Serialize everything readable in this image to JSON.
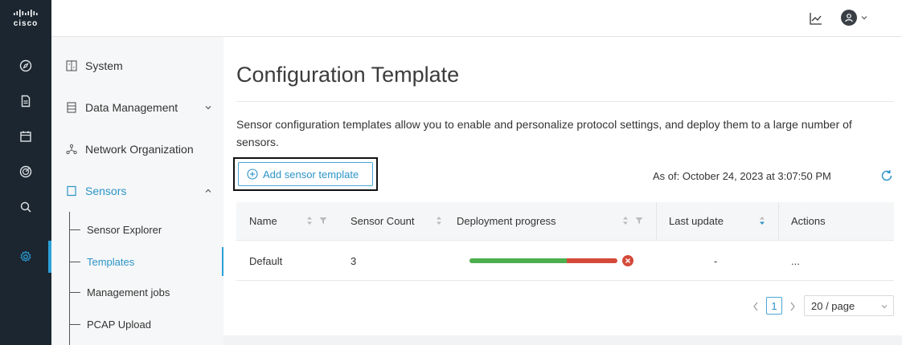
{
  "brand": {
    "name": "cisco",
    "bars": "ahah"
  },
  "rail": {
    "items": [
      {
        "icon": "compass-icon"
      },
      {
        "icon": "document-icon"
      },
      {
        "icon": "calendar-icon"
      },
      {
        "icon": "target-icon"
      },
      {
        "icon": "search-icon"
      },
      {
        "icon": "gear-icon",
        "active": true
      }
    ]
  },
  "header": {
    "icons": [
      "chart-icon",
      "user-avatar-icon",
      "chevron-down-icon"
    ]
  },
  "nav": {
    "items": [
      {
        "label": "System",
        "icon": "system-icon"
      },
      {
        "label": "Data Management",
        "icon": "database-icon",
        "expandable": true
      },
      {
        "label": "Network Organization",
        "icon": "network-icon"
      },
      {
        "label": "Sensors",
        "icon": "square-icon",
        "expanded": true
      }
    ],
    "sub_items": [
      {
        "label": "Sensor Explorer"
      },
      {
        "label": "Templates",
        "active": true
      },
      {
        "label": "Management jobs"
      },
      {
        "label": "PCAP Upload"
      }
    ]
  },
  "main": {
    "title": "Configuration Template",
    "description": "Sensor configuration templates allow you to enable and personalize protocol settings, and deploy them to a large number of sensors.",
    "add_button": "Add sensor template",
    "as_of": "As of: October 24, 2023 at 3:07:50 PM"
  },
  "table": {
    "columns": [
      "Name",
      "Sensor Count",
      "Deployment progress",
      "Last update",
      "Actions"
    ],
    "rows": [
      {
        "name": "Default",
        "sensor_count": "3",
        "deployment_success_fraction": 0.66,
        "last_update": "-",
        "actions": "..."
      }
    ]
  },
  "pagination": {
    "current": "1",
    "page_size": "20 / page"
  },
  "colors": {
    "accent": "#2c94c8",
    "rail": "#1b2630",
    "success": "#4caf50",
    "error": "#d44a3a"
  }
}
